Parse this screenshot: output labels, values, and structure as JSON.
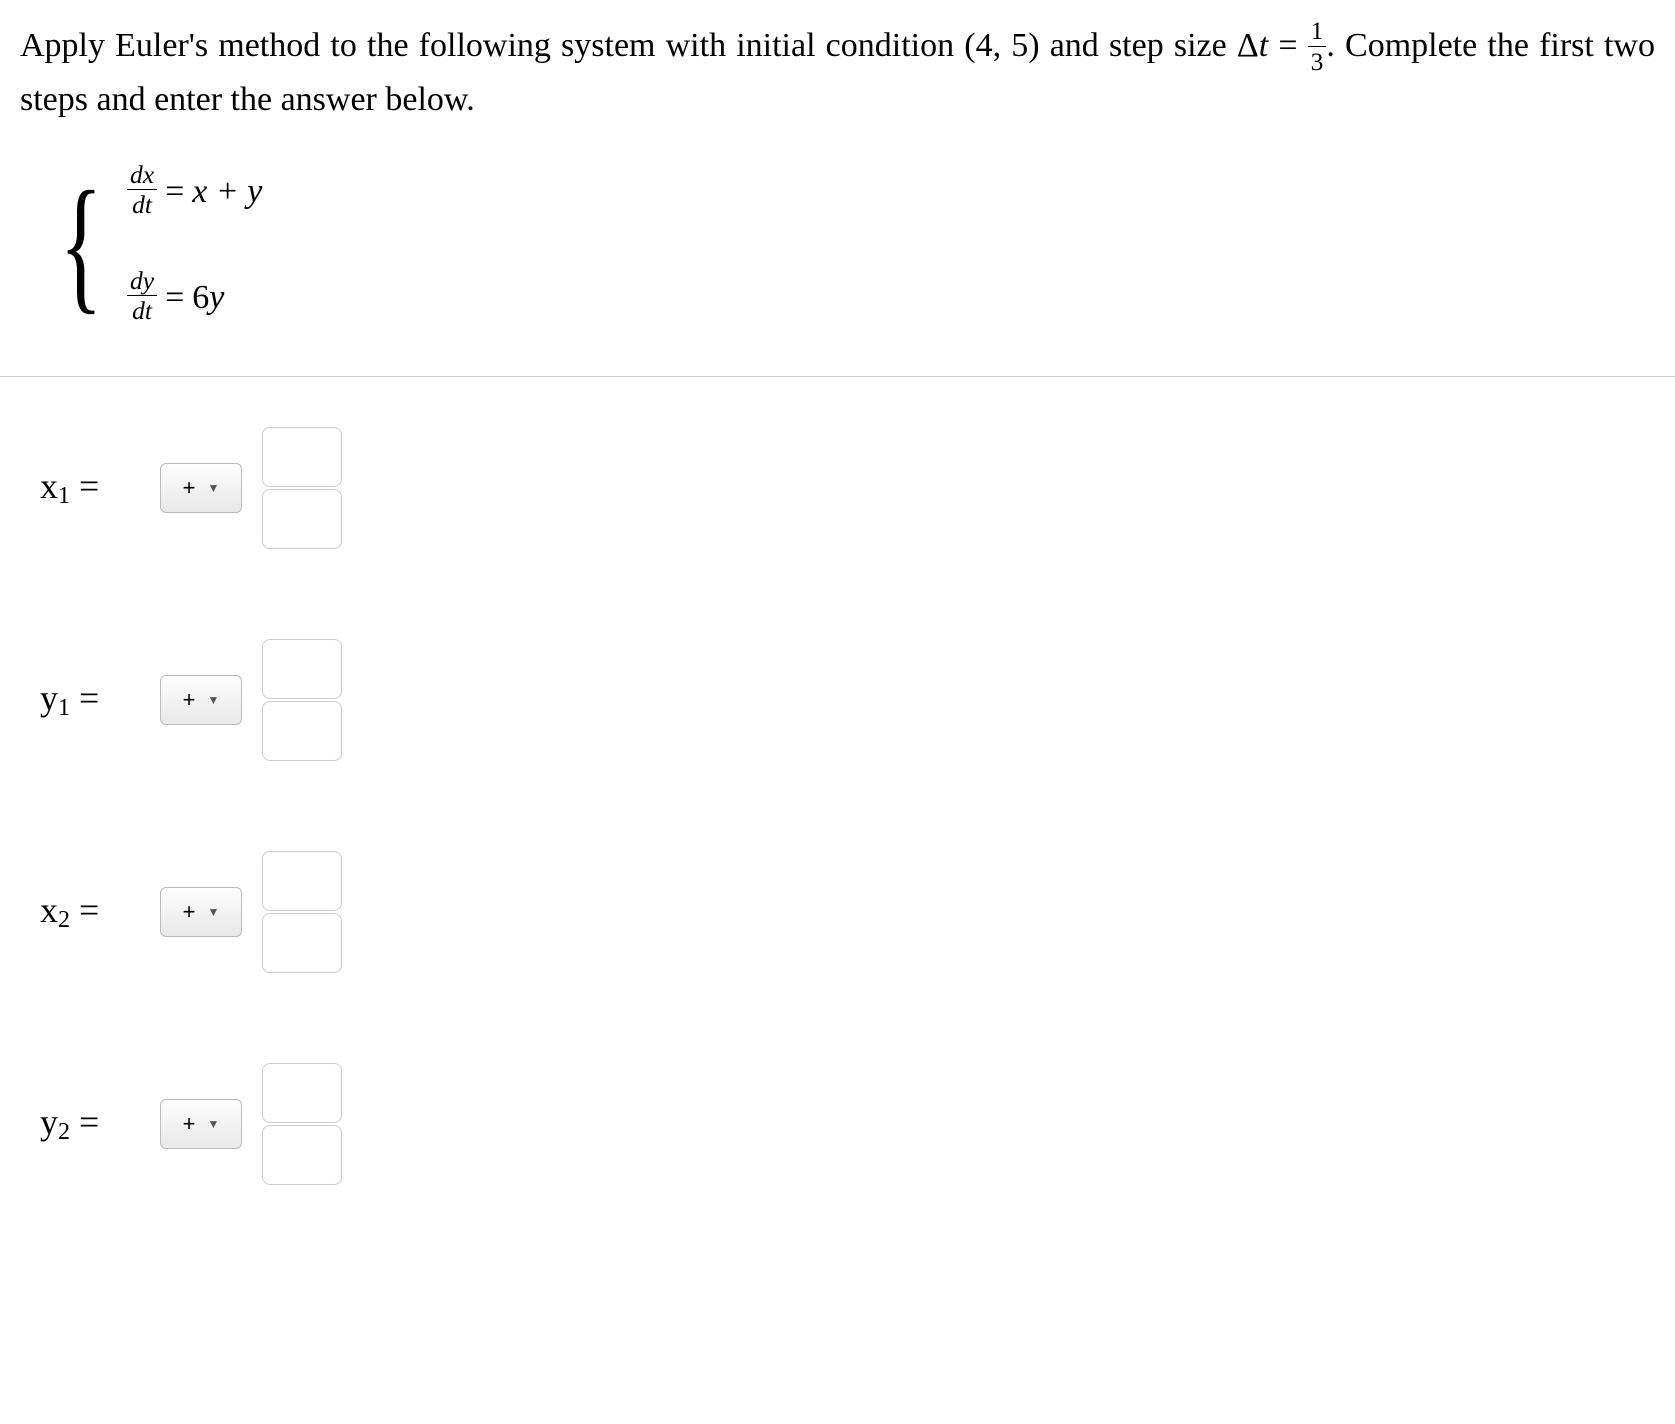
{
  "problem": {
    "text_before_ic": "Apply Euler's method to the following system with initial condition ",
    "initial_condition": "(4, 5)",
    "text_after_ic": " and step size Δ",
    "step_var": "t",
    "text_equals": " = ",
    "step_num": "1",
    "step_den": "3",
    "text_after_step": ". Complete the first two steps and enter the answer below."
  },
  "system": {
    "eq1": {
      "lhs_num": "dx",
      "lhs_den": "dt",
      "rhs": "x + y"
    },
    "eq2": {
      "lhs_num": "dy",
      "lhs_den": "dt",
      "rhs": "6y"
    }
  },
  "answers": [
    {
      "var": "x",
      "sub": "1",
      "sign": "+",
      "num": "",
      "den": ""
    },
    {
      "var": "y",
      "sub": "1",
      "sign": "+",
      "num": "",
      "den": ""
    },
    {
      "var": "x",
      "sub": "2",
      "sign": "+",
      "num": "",
      "den": ""
    },
    {
      "var": "y",
      "sub": "2",
      "sign": "+",
      "num": "",
      "den": ""
    }
  ],
  "caret": "▼",
  "equals": "="
}
